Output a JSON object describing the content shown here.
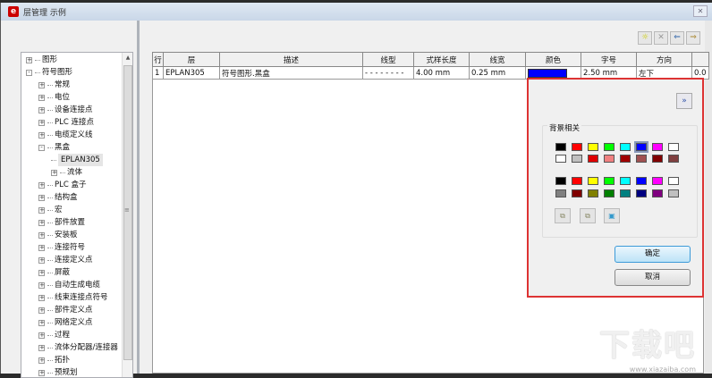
{
  "window": {
    "title": "层管理 示例",
    "logo": "e",
    "close": "✕"
  },
  "tree": [
    {
      "label": "图形",
      "level": 0,
      "state": "+"
    },
    {
      "label": "符号图形",
      "level": 0,
      "state": "-"
    },
    {
      "label": "常规",
      "level": 1,
      "state": "+"
    },
    {
      "label": "电位",
      "level": 1,
      "state": "+"
    },
    {
      "label": "设备连接点",
      "level": 1,
      "state": "+"
    },
    {
      "label": "PLC 连接点",
      "level": 1,
      "state": "+"
    },
    {
      "label": "电缆定义线",
      "level": 1,
      "state": "+"
    },
    {
      "label": "黑盒",
      "level": 1,
      "state": "-"
    },
    {
      "label": "EPLAN305",
      "level": 2,
      "state": "",
      "selected": true
    },
    {
      "label": "流体",
      "level": 2,
      "state": "+"
    },
    {
      "label": "PLC 盒子",
      "level": 1,
      "state": "+"
    },
    {
      "label": "结构盒",
      "level": 1,
      "state": "+"
    },
    {
      "label": "宏",
      "level": 1,
      "state": "+"
    },
    {
      "label": "部件放置",
      "level": 1,
      "state": "+"
    },
    {
      "label": "安装板",
      "level": 1,
      "state": "+"
    },
    {
      "label": "连接符号",
      "level": 1,
      "state": "+"
    },
    {
      "label": "连接定义点",
      "level": 1,
      "state": "+"
    },
    {
      "label": "屏蔽",
      "level": 1,
      "state": "+"
    },
    {
      "label": "自动生成电缆",
      "level": 1,
      "state": "+"
    },
    {
      "label": "线束连接点符号",
      "level": 1,
      "state": "+"
    },
    {
      "label": "部件定义点",
      "level": 1,
      "state": "+"
    },
    {
      "label": "网络定义点",
      "level": 1,
      "state": "+"
    },
    {
      "label": "过程",
      "level": 1,
      "state": "+"
    },
    {
      "label": "流体分配器/连接器",
      "level": 1,
      "state": "+"
    },
    {
      "label": "拓扑",
      "level": 1,
      "state": "+"
    },
    {
      "label": "预规划",
      "level": 1,
      "state": "+"
    }
  ],
  "toolbar": [
    "☼",
    "✕",
    "⇐",
    "⇒"
  ],
  "table": {
    "headers": [
      "行",
      "层",
      "描述",
      "线型",
      "式样长度",
      "线宽",
      "颜色",
      "字号",
      "方向",
      ""
    ],
    "rows": [
      {
        "row": "1",
        "layer": "EPLAN305",
        "desc": "符号图形.黑盒",
        "linetype": "- - - - - - - -",
        "pattern_len": "4.00 mm",
        "width": "0.25 mm",
        "color": "#0000ff",
        "font_size": "2.50 mm",
        "direction": "左下",
        "extra": "0.0"
      }
    ]
  },
  "popup": {
    "expand": "»",
    "group_label": "背景相关",
    "swatches": [
      [
        "#000000",
        "#ff0000",
        "#ffff00",
        "#00ff00",
        "#00ffff",
        "#0000ff",
        "#ff00ff",
        "#ffffff"
      ],
      [
        "#ffffff",
        "#c0c0c0",
        "#e00000",
        "#f08080",
        "#a00000",
        "#a05050",
        "#800000",
        "#804040"
      ],
      [
        "#000000",
        "#ff0000",
        "#ffff00",
        "#00ff00",
        "#00ffff",
        "#0000ff",
        "#ff00ff",
        "#ffffff"
      ],
      [
        "#808080",
        "#800000",
        "#808000",
        "#008000",
        "#008080",
        "#000080",
        "#800080",
        "#c0c0c0"
      ]
    ],
    "selected_swatch": "0-5",
    "ok": "确定",
    "cancel": "取消"
  },
  "watermark": {
    "text": "下载吧",
    "url": "www.xiazaiba.com"
  }
}
